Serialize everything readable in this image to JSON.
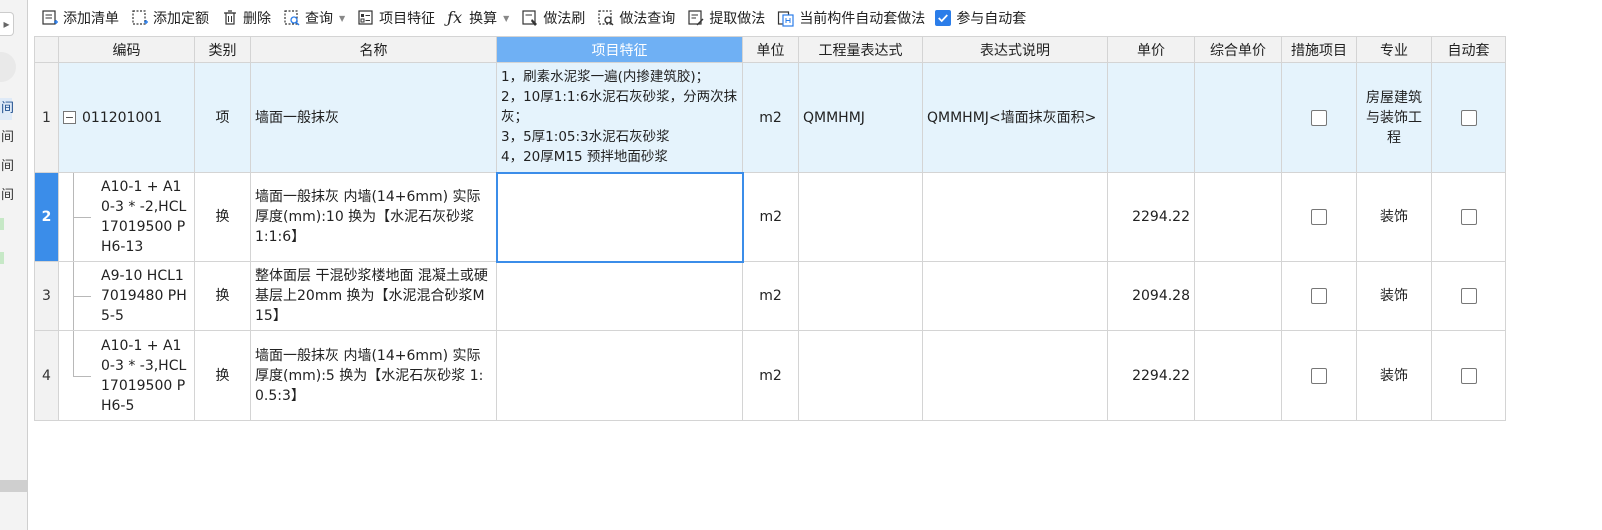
{
  "toolbar": {
    "items": [
      {
        "label": "添加清单",
        "icon": "add-list-icon"
      },
      {
        "label": "添加定额",
        "icon": "add-quota-icon"
      },
      {
        "label": "删除",
        "icon": "delete-icon"
      },
      {
        "label": "查询",
        "icon": "query-icon"
      },
      {
        "label": "项目特征",
        "icon": "item-feature-icon"
      },
      {
        "label": "换算",
        "icon": "fx-icon"
      },
      {
        "label": "做法刷",
        "icon": "method-brush-icon"
      },
      {
        "label": "做法查询",
        "icon": "method-query-icon"
      },
      {
        "label": "提取做法",
        "icon": "extract-method-icon"
      },
      {
        "label": "当前构件自动套做法",
        "icon": "auto-apply-icon"
      }
    ],
    "auto_apply_checkbox": {
      "label": "参与自动套",
      "checked": true
    }
  },
  "left_strip": {
    "tabs": [
      "间",
      "间",
      "间",
      "间"
    ]
  },
  "grid": {
    "headers": [
      "",
      "编码",
      "类别",
      "名称",
      "项目特征",
      "单位",
      "工程量表达式",
      "表达式说明",
      "单价",
      "综合单价",
      "措施项目",
      "专业",
      "自动套"
    ],
    "active_header": "项目特征",
    "rows": [
      {
        "num": "1",
        "code": "011201001",
        "type": "项",
        "name": "墙面一般抹灰",
        "features": "1，刷素水泥浆一遍(内掺建筑胶)；\n2，10厚1:1:6水泥石灰砂浆，分两次抹灰；\n3，5厚1:05:3水泥石灰砂浆\n4，20厚M15 预拌地面砂浆",
        "unit": "m2",
        "expr": "QMMHMJ",
        "expr_desc": "QMMHMJ<墙面抹灰面积>",
        "price": "",
        "comp_price": "",
        "measure": false,
        "specialty": "房屋建筑与装饰工程",
        "auto": false
      },
      {
        "num": "2",
        "code": "A10-1 + A10-3 * -2,HCL17019500 PH6-13",
        "type": "换",
        "name": "墙面一般抹灰 内墙(14+6mm) 实际厚度(mm):10 换为【水泥石灰砂浆 1:1:6】",
        "features": "",
        "unit": "m2",
        "expr": "",
        "expr_desc": "",
        "price": "2294.22",
        "comp_price": "",
        "measure": false,
        "specialty": "装饰",
        "auto": false
      },
      {
        "num": "3",
        "code": "A9-10 HCL17019480 PH5-5",
        "type": "换",
        "name": "整体面层 干混砂浆楼地面 混凝土或硬基层上20mm 换为【水泥混合砂浆M15】",
        "features": "",
        "unit": "m2",
        "expr": "",
        "expr_desc": "",
        "price": "2094.28",
        "comp_price": "",
        "measure": false,
        "specialty": "装饰",
        "auto": false
      },
      {
        "num": "4",
        "code": "A10-1 + A10-3 * -3,HCL17019500 PH6-5",
        "type": "换",
        "name": "墙面一般抹灰 内墙(14+6mm) 实际厚度(mm):5 换为【水泥石灰砂浆 1:0.5:3】",
        "features": "",
        "unit": "m2",
        "expr": "",
        "expr_desc": "",
        "price": "2294.22",
        "comp_price": "",
        "measure": false,
        "specialty": "装饰",
        "auto": false
      }
    ]
  },
  "colors": {
    "active_header": "#6fb0f4",
    "current_row": "#3b8de9",
    "parent_row_bg": "#e5f3fc",
    "checkbox_checked": "#2b7de9"
  }
}
